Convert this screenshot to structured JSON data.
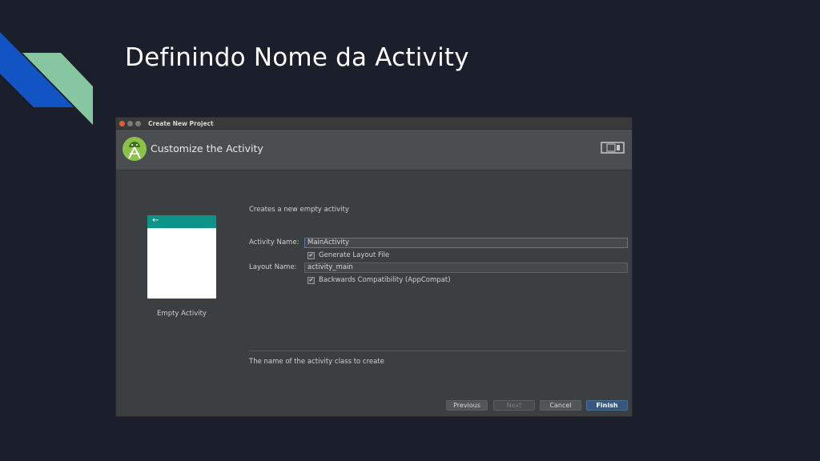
{
  "slide": {
    "title": "Definindo Nome da Activity"
  },
  "window": {
    "title": "Create New Project",
    "header_title": "Customize the Activity"
  },
  "preview": {
    "label": "Empty Activity",
    "back_glyph": "←"
  },
  "form": {
    "description": "Creates a new empty activity",
    "activity_name_label": "Activity Name:",
    "activity_name_value": "MainActivity",
    "generate_layout_label": "Generate Layout File",
    "generate_layout_checked": true,
    "layout_name_label": "Layout Name:",
    "layout_name_value": "activity_main",
    "backwards_compat_label": "Backwards Compatibility (AppCompat)",
    "backwards_compat_checked": true,
    "check_glyph": "✔",
    "hint": "The name of the activity class to create"
  },
  "buttons": {
    "previous": "Previous",
    "next": "Next",
    "cancel": "Cancel",
    "finish": "Finish"
  },
  "colors": {
    "slide_background": "#1b1f2b",
    "accent_blue": "#1254c4",
    "accent_green": "#86c6a1",
    "android_green": "#8bc34a",
    "preview_bar": "#0d9488",
    "finish_button": "#365880"
  },
  "icons": {
    "logo": "android-studio-logo-icon",
    "device": "device-preview-icon",
    "back": "back-arrow-icon",
    "check": "checkmark-icon"
  }
}
